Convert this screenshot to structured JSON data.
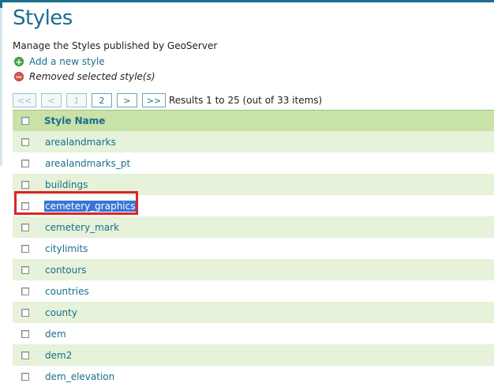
{
  "page": {
    "title": "Styles",
    "description": "Manage the Styles published by GeoServer"
  },
  "actions": {
    "add_label": "Add a new style",
    "add_icon": "+",
    "remove_label": "Removed selected style(s)",
    "remove_icon": "−"
  },
  "pager": {
    "first": "<<",
    "prev": "<",
    "current": "1",
    "page2": "2",
    "next": ">",
    "last": ">>",
    "results": "Results 1 to 25 (out of 33 items)"
  },
  "table": {
    "header": "Style Name",
    "rows": [
      {
        "name": "arealandmarks"
      },
      {
        "name": "arealandmarks_pt"
      },
      {
        "name": "buildings"
      },
      {
        "name": "cemetery_graphics"
      },
      {
        "name": "cemetery_mark"
      },
      {
        "name": "citylimits"
      },
      {
        "name": "contours"
      },
      {
        "name": "countries"
      },
      {
        "name": "county"
      },
      {
        "name": "dem"
      },
      {
        "name": "dem2"
      },
      {
        "name": "dem_elevation"
      }
    ]
  },
  "colors": {
    "title": "#1a6e8e",
    "link": "#1a6e8e",
    "header_bg": "#c8e2a8",
    "odd_row_bg": "#e6f2d9",
    "selection_bg": "#3875d7",
    "highlight_border": "#d8262a"
  }
}
